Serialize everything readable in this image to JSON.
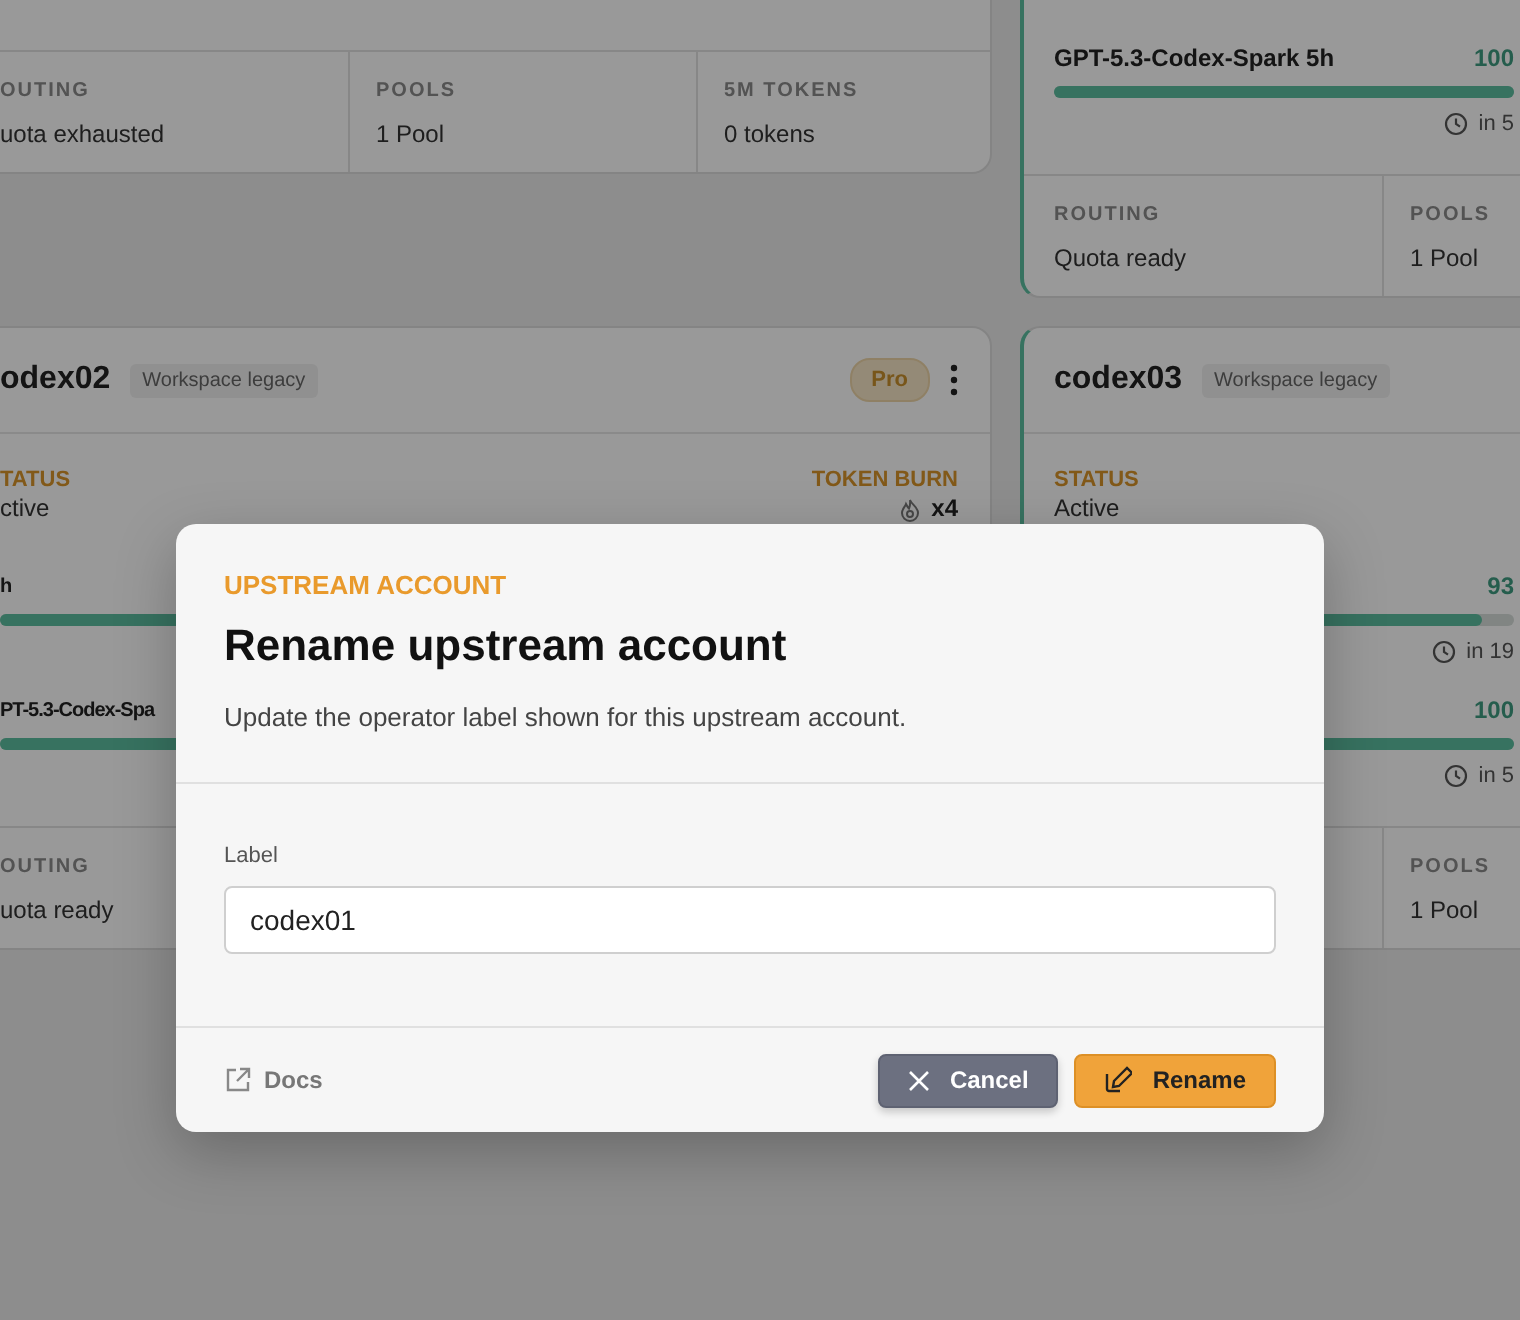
{
  "columns": [
    {
      "cards": [
        {
          "kind": "stats",
          "highlighted": false,
          "stats": [
            {
              "kind": "text",
              "label": "OUTING",
              "value": "uota exhausted"
            },
            {
              "kind": "text",
              "label": "POOLS",
              "value": "1 Pool"
            },
            {
              "kind": "text",
              "label": "5M TOKENS",
              "value": "0 tokens"
            }
          ]
        },
        {
          "kind": "full",
          "highlighted": false,
          "name": "odex02",
          "tag": "Workspace legacy",
          "badge": "Pro",
          "status_label": "TATUS",
          "status": "ctive",
          "token_burn_label": "TOKEN BURN",
          "token_burn": "x4",
          "quotas": [
            {
              "label": "h",
              "level": 1
            },
            {
              "label": "PT-5.3-Codex-Spa",
              "level": 1
            }
          ],
          "stats": [
            {
              "kind": "text",
              "label": "OUTING",
              "value": "uota ready"
            }
          ]
        }
      ]
    },
    {
      "cards": [
        {
          "kind": "quota",
          "highlighted": true,
          "quotas": [
            {
              "label": "GPT-5.3-Codex-Spark 5h",
              "percent": "100",
              "level": 1,
              "reset": "in 5"
            }
          ],
          "stats": [
            {
              "kind": "text",
              "label": "ROUTING",
              "value": "Quota ready"
            },
            {
              "kind": "text",
              "label": "POOLS",
              "value": "1 Pool"
            }
          ]
        },
        {
          "kind": "full",
          "highlighted": true,
          "name": "codex03",
          "tag": "Workspace legacy",
          "status_label": "STATUS",
          "status": "Active",
          "quotas": [
            {
              "percent": "93",
              "level": 0.93,
              "reset": "in 19"
            },
            {
              "percent": "100",
              "level": 1,
              "reset": "in 5"
            }
          ],
          "stats": [
            {
              "kind": "covered"
            },
            {
              "kind": "text",
              "label": "POOLS",
              "value": "1 Pool"
            }
          ]
        }
      ]
    }
  ],
  "dialog": {
    "eyebrow": "UPSTREAM ACCOUNT",
    "title": "Rename upstream account",
    "description": "Update the operator label shown for this upstream account.",
    "field": {
      "label": "Label",
      "value": "codex01"
    },
    "docs_link": "Docs",
    "buttons": [
      {
        "kind": "cancel",
        "label": "Cancel"
      },
      {
        "kind": "confirm",
        "label": "Rename"
      }
    ]
  }
}
